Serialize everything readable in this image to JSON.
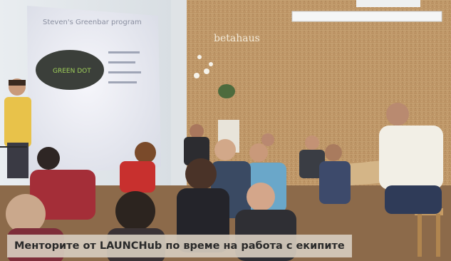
{
  "photo": {
    "screen_title": "Steven's Greenbar program",
    "screen_logo": "GREEN DOT",
    "wall_sign": "betahaus",
    "bullets": [
      "~~~~",
      "~~~~~",
      "~~~~~~",
      "~~~~~"
    ]
  },
  "caption": {
    "text": "Менторите от LAUNCHub по време на работа с екипите"
  }
}
